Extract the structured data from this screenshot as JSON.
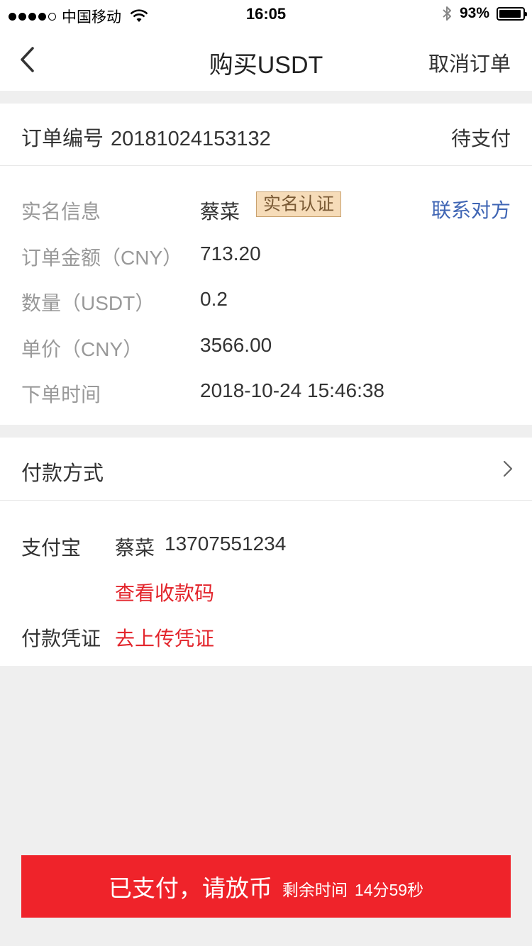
{
  "status_bar": {
    "carrier": "中国移动",
    "time": "16:05",
    "battery": "93%",
    "battery_level": 0.93,
    "signal_bars": 4,
    "signal_total": 5
  },
  "nav": {
    "title": "购买USDT",
    "cancel_label": "取消订单"
  },
  "order": {
    "number_label": "订单编号",
    "number": "20181024153132",
    "status": "待支付",
    "rows": [
      {
        "label": "实名信息",
        "value": "蔡菜"
      },
      {
        "label": "订单金额（CNY）",
        "value": "713.20"
      },
      {
        "label": "数量（USDT）",
        "value": "0.2"
      },
      {
        "label": "单价（CNY）",
        "value": "3566.00"
      },
      {
        "label": "下单时间",
        "value": "2018-10-24 15:46:38"
      }
    ],
    "verify_badge": "实名认证",
    "contact_label": "联系对方"
  },
  "payment": {
    "title": "付款方式",
    "method_label": "支付宝",
    "payee_name": "蔡菜",
    "payee_account": "13707551234",
    "qr_link": "查看收款码",
    "voucher_label": "付款凭证",
    "voucher_link": "去上传凭证"
  },
  "footer": {
    "confirm_label": "已支付，请放币",
    "remaining_label": "剩余时间",
    "remaining_time": "14分59秒"
  },
  "colors": {
    "accent_red": "#ef232a",
    "link_red": "#e3262d",
    "link_blue": "#3f65b4",
    "badge_bg": "#f6dcb9"
  }
}
